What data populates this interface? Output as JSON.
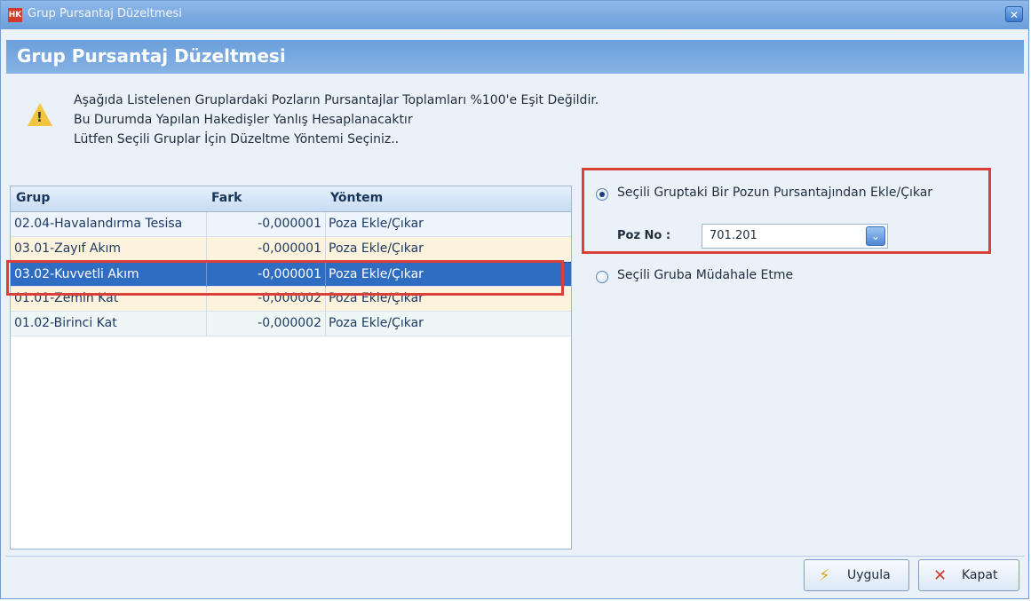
{
  "window": {
    "icon_text": "HK",
    "title": "Grup Pursantaj Düzeltmesi",
    "close_icon": "close-icon"
  },
  "header": {
    "title": "Grup Pursantaj Düzeltmesi"
  },
  "message": {
    "icon": "warning-icon",
    "line1": "Aşağıda Listelenen Gruplardaki Pozların Pursantajlar Toplamları  %100'e Eşit Değildir.",
    "line2": "Bu Durumda Yapılan Hakedişler Yanlış Hesaplanacaktır",
    "line3": "Lütfen Seçili Gruplar İçin Düzeltme Yöntemi Seçiniz.."
  },
  "grid": {
    "columns": [
      "Grup",
      "Fark",
      "Yöntem"
    ],
    "rows": [
      {
        "grup": "02.04-Havalandırma Tesisa",
        "fark": "-0,000001",
        "yontem": "Poza Ekle/Çıkar"
      },
      {
        "grup": "03.01-Zayıf Akım",
        "fark": "-0,000001",
        "yontem": "Poza Ekle/Çıkar"
      },
      {
        "grup": "03.02-Kuvvetli Akım",
        "fark": "-0,000001",
        "yontem": "Poza Ekle/Çıkar"
      },
      {
        "grup": "01.01-Zemin Kat",
        "fark": "-0,000002",
        "yontem": "Poza Ekle/Çıkar"
      },
      {
        "grup": "01.02-Birinci Kat",
        "fark": "-0,000002",
        "yontem": "Poza Ekle/Çıkar"
      }
    ],
    "selected_row": 2
  },
  "options": {
    "option1_label": "Seçili Gruptaki Bir Pozun Pursantajından Ekle/Çıkar",
    "option2_label": "Seçili Gruba Müdahale Etme",
    "selected": 1,
    "poz_label": "Poz No :",
    "poz_value": "701.201"
  },
  "buttons": {
    "apply_label": "Uygula",
    "apply_icon": "lightning-icon",
    "close_label": "Kapat",
    "close_icon": "x-icon"
  },
  "colors": {
    "accent": "#6b9fdb",
    "selection": "#2f6dc2",
    "highlight_box": "#d9403a"
  }
}
